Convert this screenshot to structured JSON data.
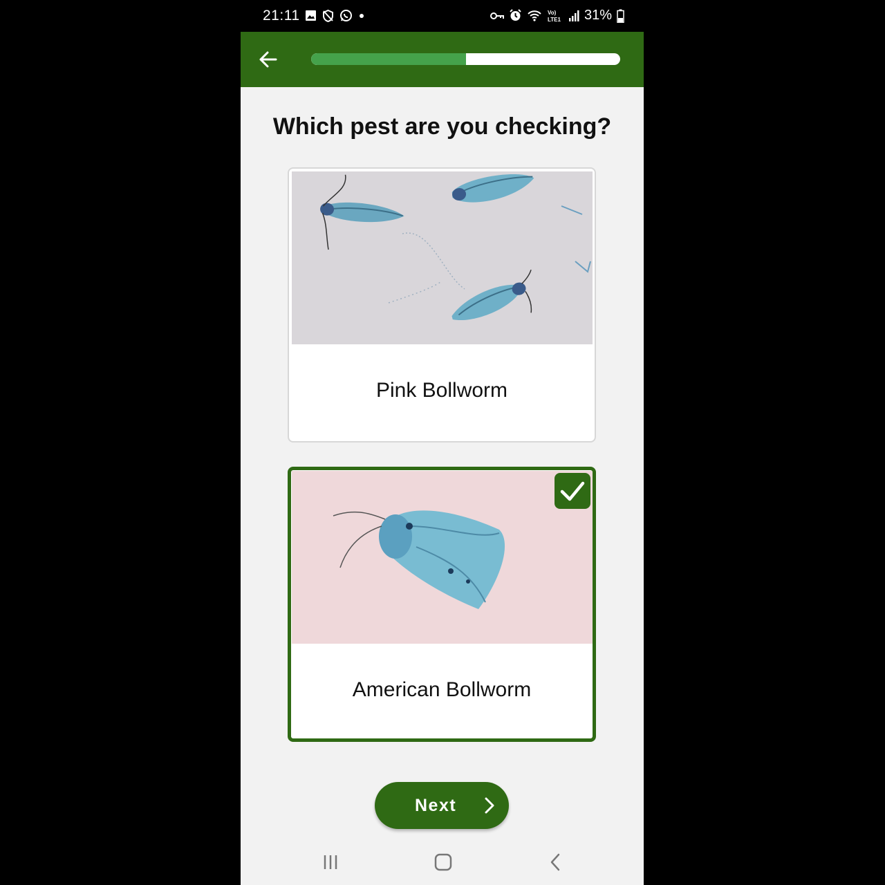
{
  "status_bar": {
    "time": "21:11",
    "battery": "31%",
    "icons": [
      "gallery-icon",
      "shield-icon",
      "whatsapp-icon",
      "dot-icon",
      "vpn-key-icon",
      "alarm-icon",
      "wifi-icon",
      "volte-icon",
      "signal-icon",
      "battery-icon"
    ]
  },
  "header": {
    "back_icon": "arrow-left-icon",
    "progress": 0.5
  },
  "page": {
    "title": "Which pest are you checking?"
  },
  "options": [
    {
      "label": "Pink Bollworm",
      "selected": false
    },
    {
      "label": "American Bollworm",
      "selected": true
    }
  ],
  "footer": {
    "next_label": "Next",
    "next_icon": "chevron-right-icon"
  },
  "colors": {
    "primary": "#2f6a14",
    "progress": "#45a24b",
    "background": "#f2f2f2"
  },
  "nav": [
    "recents-icon",
    "home-icon",
    "back-icon"
  ]
}
